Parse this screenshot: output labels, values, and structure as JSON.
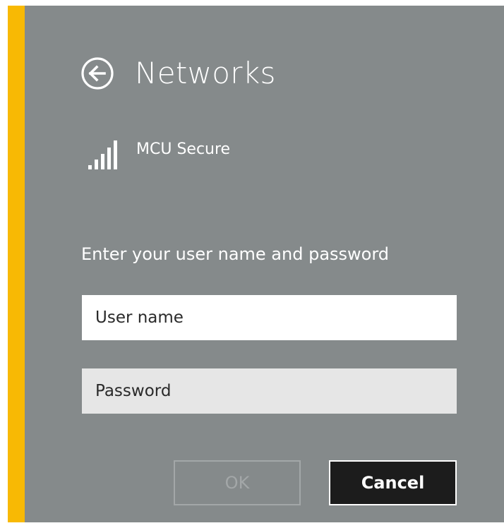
{
  "header": {
    "title": "Networks",
    "back_icon": "back-arrow-circle-icon"
  },
  "network": {
    "name": "MCU Secure",
    "signal_icon": "wifi-signal-bars-icon"
  },
  "form": {
    "prompt": "Enter your user name and password",
    "username_placeholder": "User name",
    "password_placeholder": "Password"
  },
  "buttons": {
    "ok_label": "OK",
    "cancel_label": "Cancel"
  },
  "colors": {
    "accent": "#f8b904",
    "panel_bg": "#858a8b",
    "ok_disabled": "#a3a7a8",
    "cancel_bg": "#1c1c1c"
  }
}
